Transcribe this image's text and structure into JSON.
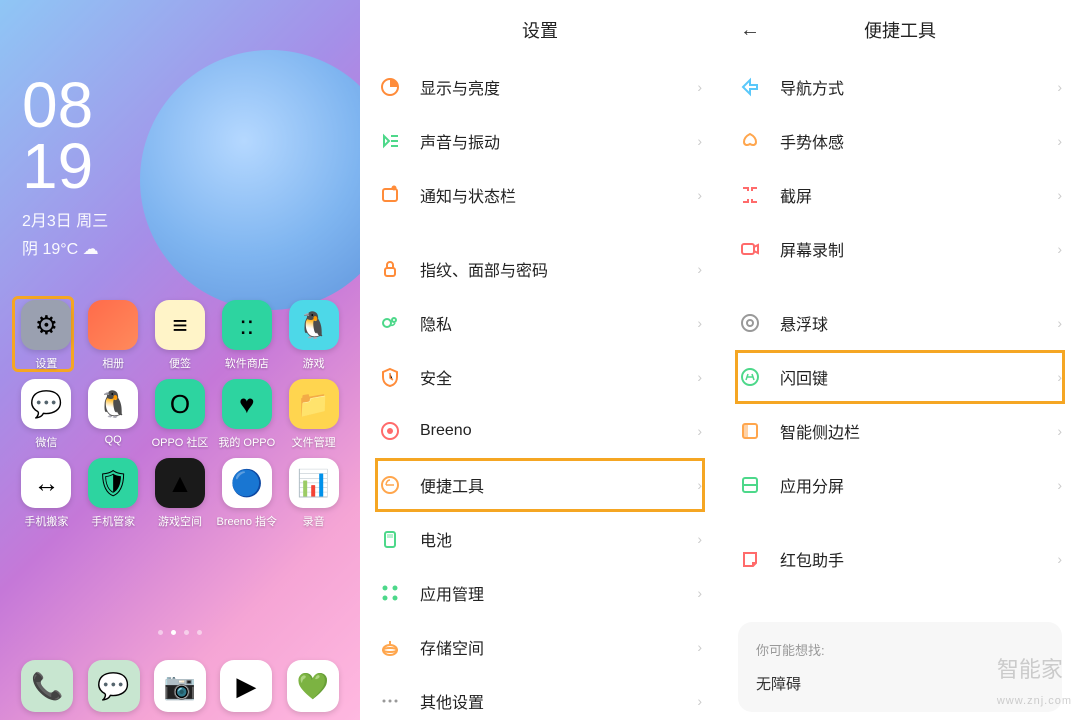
{
  "home": {
    "time_top": "08",
    "time_bottom": "19",
    "date": "2月3日 周三",
    "weather": "阴 19°C ☁",
    "apps_row1": [
      {
        "label": "设置",
        "bg": "#9aa0b0",
        "emoji": "⚙"
      },
      {
        "label": "相册",
        "bg": "linear-gradient(135deg,#ff6b4a,#ff8a5c)",
        "emoji": ""
      },
      {
        "label": "便签",
        "bg": "#fff4c8",
        "emoji": "≡"
      },
      {
        "label": "软件商店",
        "bg": "#2dd4a0",
        "emoji": "::"
      },
      {
        "label": "游戏",
        "bg": "#4dd8e8",
        "emoji": "🐧"
      }
    ],
    "apps_row2": [
      {
        "label": "微信",
        "bg": "#fff",
        "emoji": "💬"
      },
      {
        "label": "QQ",
        "bg": "#fff",
        "emoji": "🐧"
      },
      {
        "label": "OPPO 社区",
        "bg": "#2dd4a0",
        "emoji": "O"
      },
      {
        "label": "我的 OPPO",
        "bg": "#2dd4a0",
        "emoji": "♥"
      },
      {
        "label": "文件管理",
        "bg": "#ffd54f",
        "emoji": "📁"
      }
    ],
    "apps_row3": [
      {
        "label": "手机搬家",
        "bg": "#fff",
        "emoji": "↔"
      },
      {
        "label": "手机管家",
        "bg": "#2dd4a0",
        "emoji": "🛡"
      },
      {
        "label": "游戏空间",
        "bg": "#1a1a1a",
        "emoji": "▲"
      },
      {
        "label": "Breeno 指令",
        "bg": "#fff",
        "emoji": "🔵"
      },
      {
        "label": "录音",
        "bg": "#fff",
        "emoji": "📊"
      }
    ],
    "dock": [
      {
        "bg": "#c8e6d0",
        "emoji": "📞"
      },
      {
        "bg": "#c8e6d0",
        "emoji": "💬"
      },
      {
        "bg": "#fff",
        "emoji": "📷"
      },
      {
        "bg": "#fff",
        "emoji": "▶"
      },
      {
        "bg": "#fff",
        "emoji": "💚"
      }
    ]
  },
  "settings": {
    "title": "设置",
    "items": [
      {
        "label": "显示与亮度",
        "iconcolor": "#ff8c3a"
      },
      {
        "label": "声音与振动",
        "iconcolor": "#4dd88a"
      },
      {
        "label": "通知与状态栏",
        "iconcolor": "#ff8c3a"
      }
    ],
    "items2": [
      {
        "label": "指纹、面部与密码",
        "iconcolor": "#ff8c3a"
      },
      {
        "label": "隐私",
        "iconcolor": "#4dd88a"
      },
      {
        "label": "安全",
        "iconcolor": "#ff8c3a"
      },
      {
        "label": "Breeno",
        "iconcolor": "#ff6b6b"
      },
      {
        "label": "便捷工具",
        "iconcolor": "#ffa64d",
        "highlight": true
      },
      {
        "label": "电池",
        "iconcolor": "#4dd88a"
      },
      {
        "label": "应用管理",
        "iconcolor": "#4dd88a"
      },
      {
        "label": "存储空间",
        "iconcolor": "#ffa64d"
      },
      {
        "label": "其他设置",
        "iconcolor": "#999"
      }
    ]
  },
  "tools": {
    "title": "便捷工具",
    "items": [
      {
        "label": "导航方式",
        "iconcolor": "#5ac8fa"
      },
      {
        "label": "手势体感",
        "iconcolor": "#ffa64d"
      },
      {
        "label": "截屏",
        "iconcolor": "#ff6b6b"
      },
      {
        "label": "屏幕录制",
        "iconcolor": "#ff6b6b"
      }
    ],
    "items2": [
      {
        "label": "悬浮球",
        "iconcolor": "#999"
      },
      {
        "label": "闪回键",
        "iconcolor": "#4dd88a",
        "highlight": true
      },
      {
        "label": "智能侧边栏",
        "iconcolor": "#ffa64d"
      },
      {
        "label": "应用分屏",
        "iconcolor": "#4dd88a"
      }
    ],
    "items3": [
      {
        "label": "红包助手",
        "iconcolor": "#ff6b6b"
      }
    ],
    "suggest_title": "你可能想找:",
    "suggest_item": "无障碍"
  },
  "watermark": {
    "top": "智能家",
    "bottom": "www.znj.com"
  }
}
